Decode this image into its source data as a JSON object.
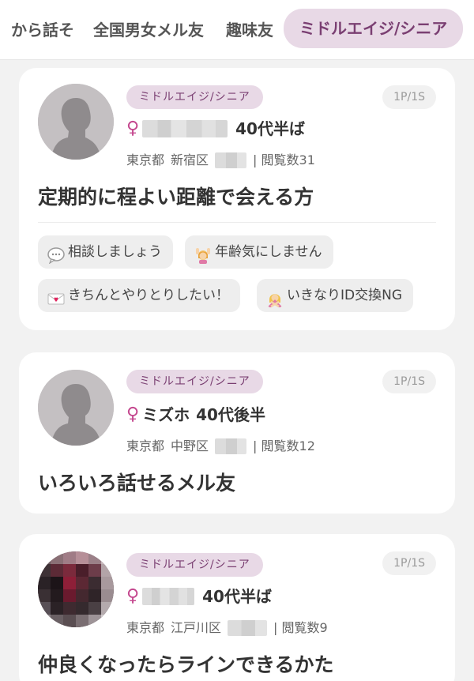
{
  "tabs": [
    {
      "label": "から話そ",
      "active": false
    },
    {
      "label": "全国男女メル友",
      "active": false
    },
    {
      "label": "趣味友",
      "active": false
    },
    {
      "label": "ミドルエイジ/シニア",
      "active": true
    }
  ],
  "posts": [
    {
      "category": "ミドルエイジ/シニア",
      "pages": "1P/1S",
      "gender_symbol": "♀",
      "name": "",
      "age": "40代半ば",
      "prefecture": "東京都",
      "city": "新宿区",
      "views": "| 閲覧数31",
      "title": "定期的に程よい距離で会える方",
      "tags": [
        {
          "icon": "speech-bubble-icon",
          "label": "相談しましょう"
        },
        {
          "icon": "woman-raising-hands-icon",
          "label": "年齢気にしません"
        },
        {
          "icon": "love-letter-icon",
          "label": "きちんとやりとりしたい！"
        },
        {
          "icon": "woman-gesturing-no-icon",
          "label": "いきなりID交換NG"
        }
      ]
    },
    {
      "category": "ミドルエイジ/シニア",
      "pages": "1P/1S",
      "gender_symbol": "♀",
      "name": "ミズホ",
      "age": "40代後半",
      "prefecture": "東京都",
      "city": "中野区",
      "views": "| 閲覧数12",
      "title": "いろいろ話せるメル友",
      "tags": []
    },
    {
      "category": "ミドルエイジ/シニア",
      "pages": "1P/1S",
      "gender_symbol": "♀",
      "name": "",
      "age": "40代半ば",
      "prefecture": "東京都",
      "city": "江戸川区",
      "views": "| 閲覧数9",
      "title": "仲良くなったらラインできるかた",
      "tags": []
    }
  ],
  "colors": {
    "accent": "#7a3f72",
    "badge_bg": "#e8d9e6",
    "female": "#c4478e",
    "background": "#f2f2f2"
  }
}
